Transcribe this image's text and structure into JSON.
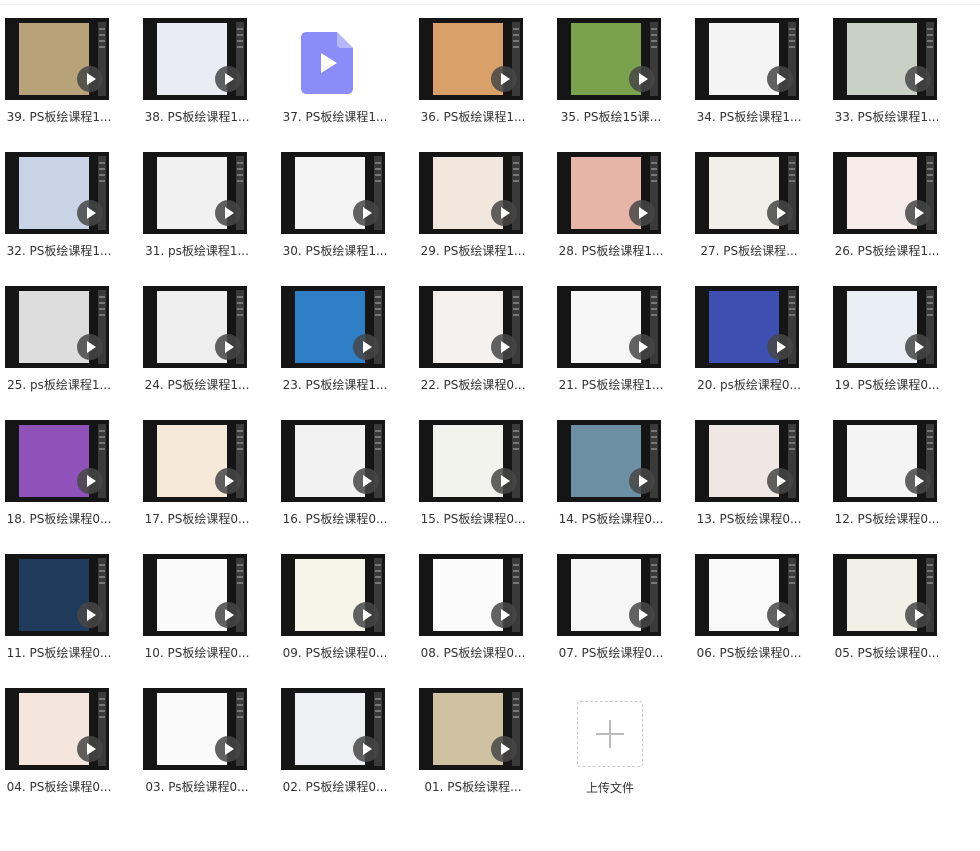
{
  "files": [
    {
      "label": "39. PS板绘课程1...",
      "type": "video",
      "art": "#b7a27a"
    },
    {
      "label": "38. PS板绘课程1...",
      "type": "video",
      "art": "#e9edf3"
    },
    {
      "label": "37. PS板绘课程1...",
      "type": "file",
      "art": "#8b8cf7"
    },
    {
      "label": "36. PS板绘课程1...",
      "type": "video",
      "art": "#d9a06a"
    },
    {
      "label": "35. PS板绘15课...",
      "type": "video",
      "art": "#7aa24e"
    },
    {
      "label": "34. PS板绘课程1...",
      "type": "video",
      "art": "#f4f4f4"
    },
    {
      "label": "33. PS板绘课程1...",
      "type": "video",
      "art": "#c9d1c6"
    },
    {
      "label": "32. PS板绘课程1...",
      "type": "video",
      "art": "#c8d3e6"
    },
    {
      "label": "31. ps板绘课程1...",
      "type": "video",
      "art": "#f1f1f1"
    },
    {
      "label": "30. PS板绘课程1...",
      "type": "video",
      "art": "#f4f4f4"
    },
    {
      "label": "29. PS板绘课程1...",
      "type": "video",
      "art": "#f2e7dc"
    },
    {
      "label": "28. PS板绘课程1...",
      "type": "video",
      "art": "#e6b5a8"
    },
    {
      "label": "27. PS板绘课程...",
      "type": "video",
      "art": "#f0efe9"
    },
    {
      "label": "26. PS板绘课程1...",
      "type": "video",
      "art": "#f8ecea"
    },
    {
      "label": "25. ps板绘课程1...",
      "type": "video",
      "art": "#dddddd"
    },
    {
      "label": "24. PS板绘课程1...",
      "type": "video",
      "art": "#efefef"
    },
    {
      "label": "23. PS板绘课程1...",
      "type": "video",
      "art": "#2f7fc6"
    },
    {
      "label": "22. PS板绘课程0...",
      "type": "video",
      "art": "#f5f1ee"
    },
    {
      "label": "21. PS板绘课程1...",
      "type": "video",
      "art": "#f6f6f6"
    },
    {
      "label": "20. ps板绘课程0...",
      "type": "video",
      "art": "#3d4fb0"
    },
    {
      "label": "19. PS板绘课程0...",
      "type": "video",
      "art": "#e8eef4"
    },
    {
      "label": "18. PS板绘课程0...",
      "type": "video",
      "art": "#8f52b8"
    },
    {
      "label": "17. PS板绘课程0...",
      "type": "video",
      "art": "#f7e9d9"
    },
    {
      "label": "16. PS板绘课程0...",
      "type": "video",
      "art": "#f2f2f2"
    },
    {
      "label": "15. PS板绘课程0...",
      "type": "video",
      "art": "#f3f3ee"
    },
    {
      "label": "14. PS板绘课程0...",
      "type": "video",
      "art": "#6c8fa4"
    },
    {
      "label": "13. PS板绘课程0...",
      "type": "video",
      "art": "#efe7e3"
    },
    {
      "label": "12. PS板绘课程0...",
      "type": "video",
      "art": "#f4f4f4"
    },
    {
      "label": "11. PS板绘课程0...",
      "type": "video",
      "art": "#1f3a5a"
    },
    {
      "label": "10. PS板绘课程0...",
      "type": "video",
      "art": "#fafafa"
    },
    {
      "label": "09. PS板绘课程0...",
      "type": "video",
      "art": "#f7f4ea"
    },
    {
      "label": "08. PS板绘课程0...",
      "type": "video",
      "art": "#fbfbfb"
    },
    {
      "label": "07. PS板绘课程0...",
      "type": "video",
      "art": "#f6f6f6"
    },
    {
      "label": "06. PS板绘课程0...",
      "type": "video",
      "art": "#f9f9f9"
    },
    {
      "label": "05. PS板绘课程0...",
      "type": "video",
      "art": "#f2efe7"
    },
    {
      "label": "04. PS板绘课程0...",
      "type": "video",
      "art": "#f4e6dd"
    },
    {
      "label": "03. Ps板绘课程0...",
      "type": "video",
      "art": "#fafafa"
    },
    {
      "label": "02. PS板绘课程0...",
      "type": "video",
      "art": "#eef0f4"
    },
    {
      "label": "01. PS板绘课程...",
      "type": "video",
      "art": "#cfc2a2"
    }
  ],
  "upload": {
    "label": "上传文件"
  },
  "colors": {
    "play": "#464646",
    "file_icon": "#8b8cf7"
  }
}
